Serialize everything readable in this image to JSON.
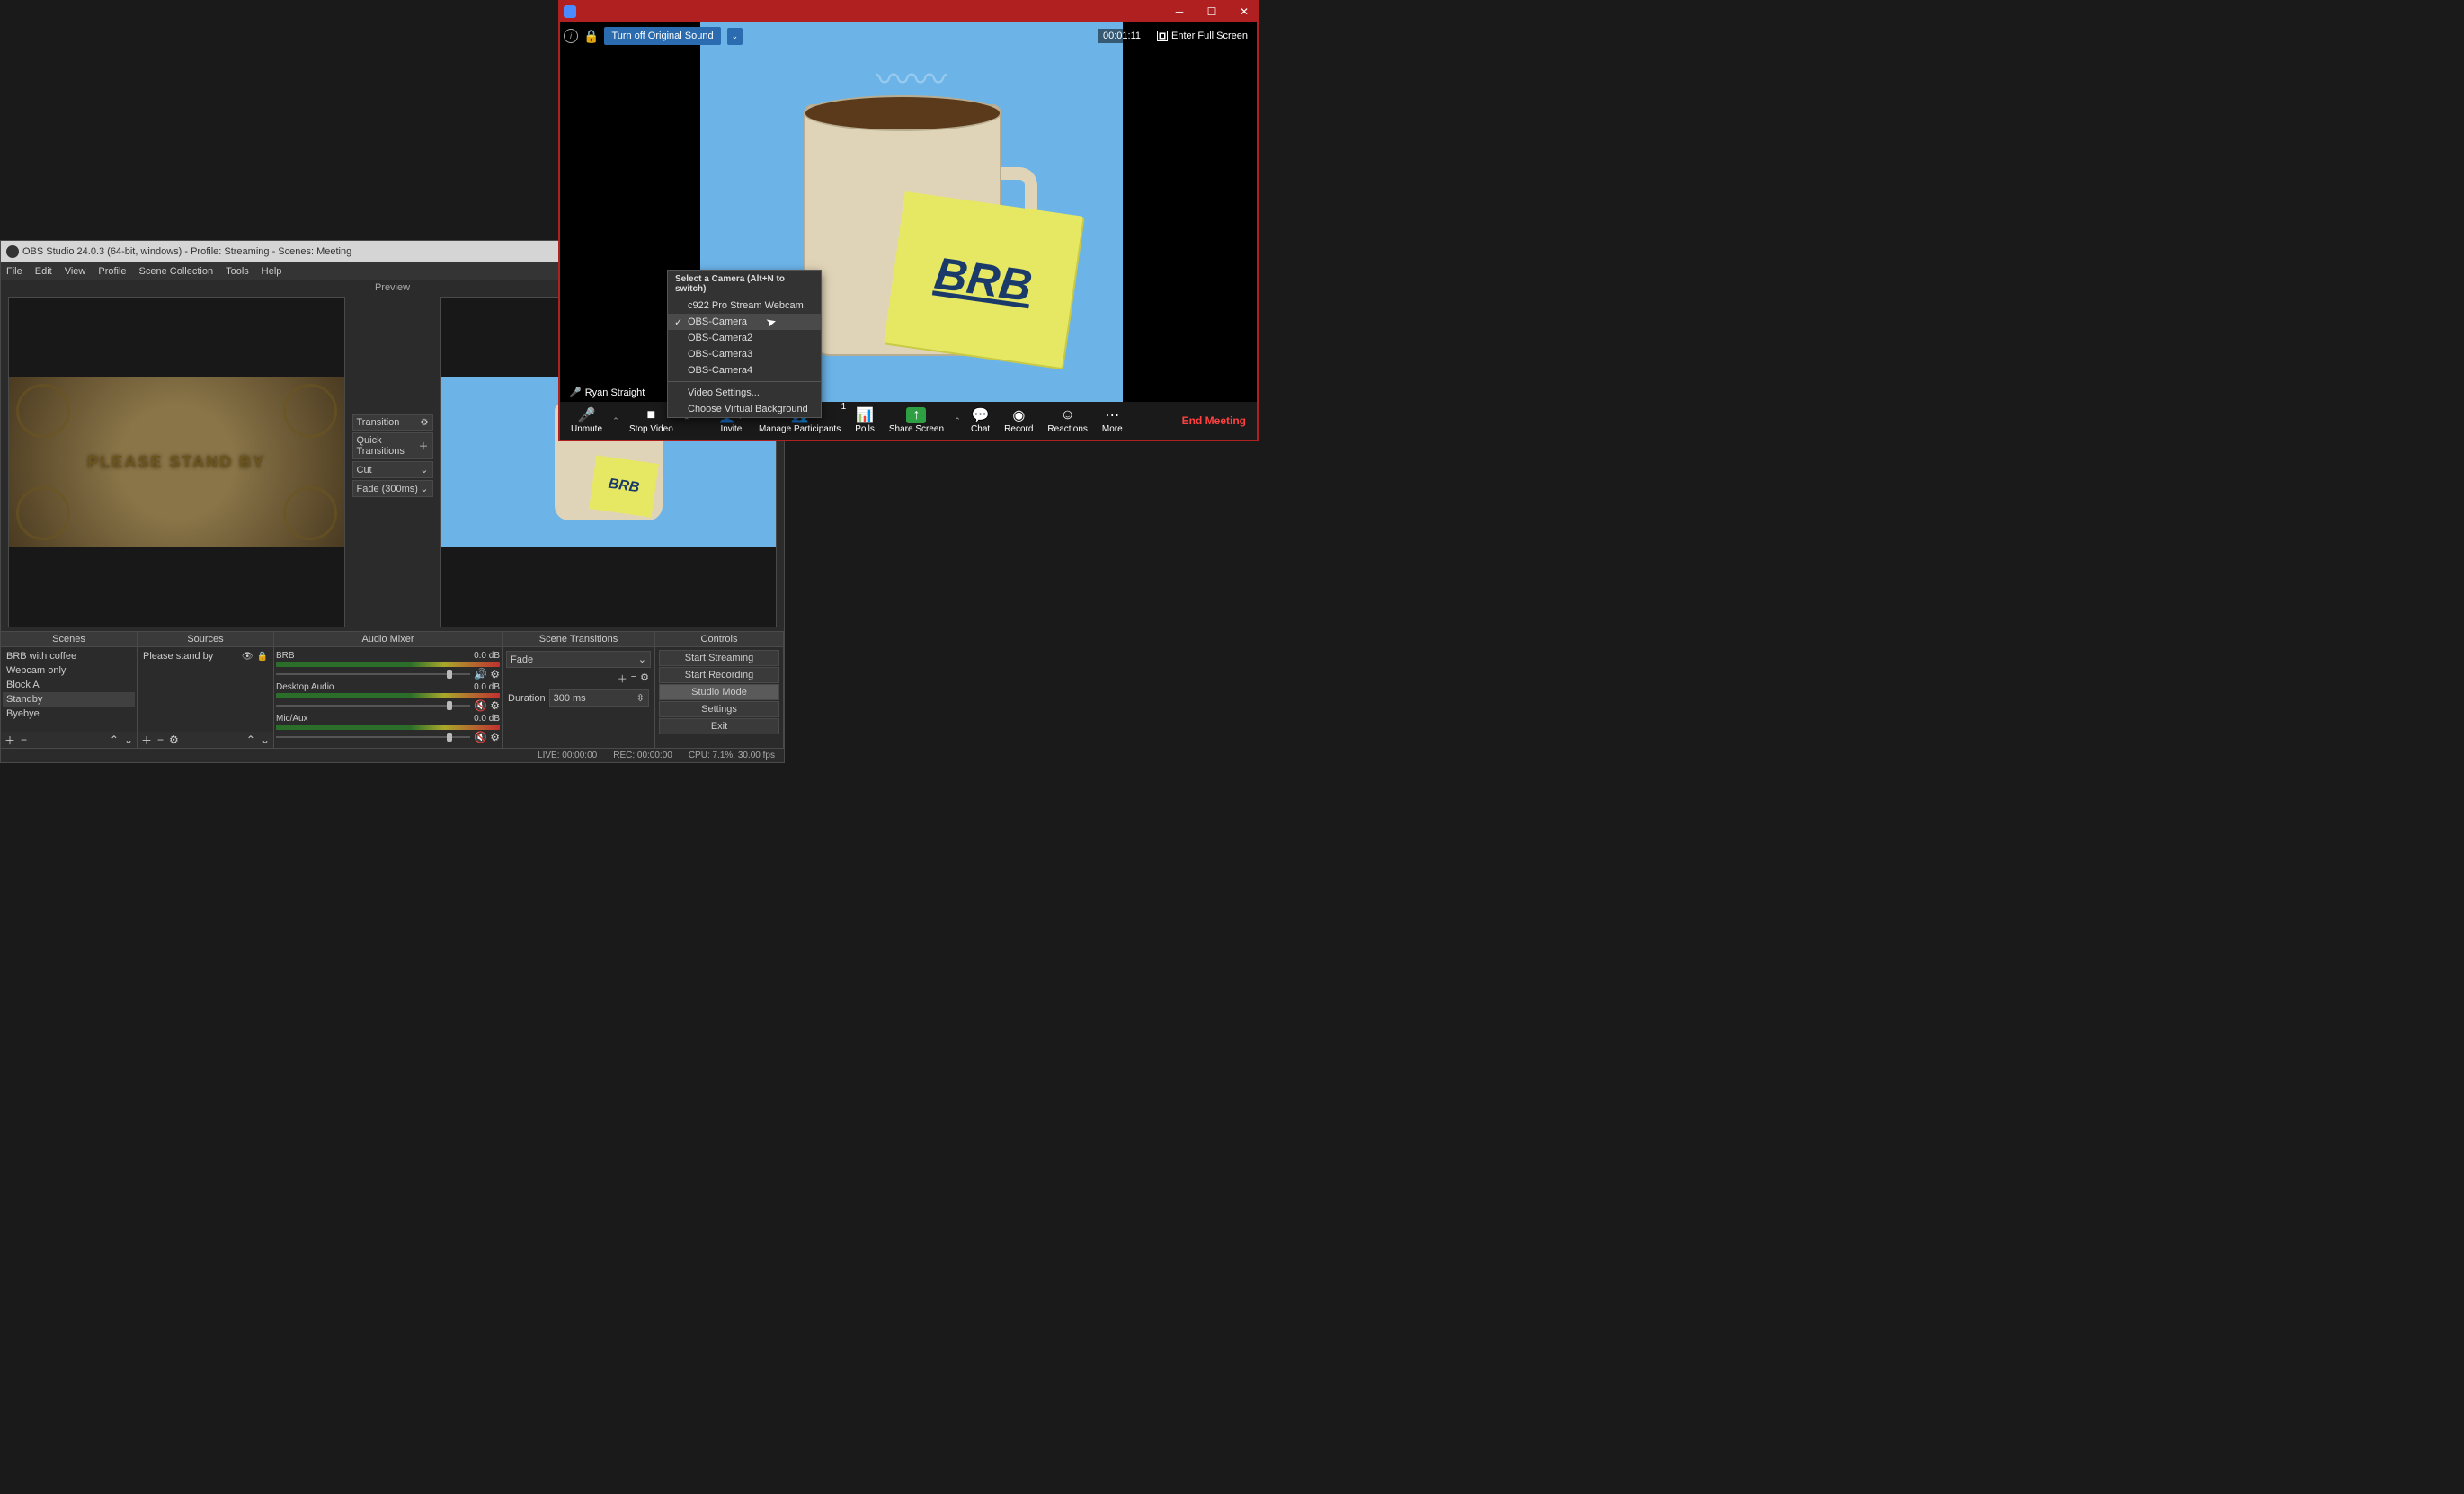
{
  "obs": {
    "title": "OBS Studio 24.0.3 (64-bit, windows) - Profile: Streaming - Scenes: Meeting",
    "menu": {
      "file": "File",
      "edit": "Edit",
      "view": "View",
      "profile": "Profile",
      "scenecol": "Scene Collection",
      "tools": "Tools",
      "help": "Help"
    },
    "preview_label": "Preview",
    "standby_text": "PLEASE STAND BY",
    "brb_text": "BRB",
    "transition": {
      "transition": "Transition",
      "quick": "Quick Transitions",
      "cut": "Cut",
      "fade": "Fade (300ms)"
    },
    "panels": {
      "scenes_title": "Scenes",
      "sources_title": "Sources",
      "mixer_title": "Audio Mixer",
      "trans_title": "Scene Transitions",
      "controls_title": "Controls"
    },
    "scenes": [
      "BRB with coffee",
      "Webcam only",
      "Block A",
      "Standby",
      "Byebye"
    ],
    "sources": [
      "Please stand by"
    ],
    "mixer": [
      {
        "name": "BRB",
        "db": "0.0 dB",
        "muted": false
      },
      {
        "name": "Desktop Audio",
        "db": "0.0 dB",
        "muted": true
      },
      {
        "name": "Mic/Aux",
        "db": "0.0 dB",
        "muted": true
      }
    ],
    "trans": {
      "type": "Fade",
      "dur_label": "Duration",
      "dur": "300 ms"
    },
    "controls": [
      "Start Streaming",
      "Start Recording",
      "Studio Mode",
      "Settings",
      "Exit"
    ],
    "status": {
      "live": "LIVE: 00:00:00",
      "rec": "REC: 00:00:00",
      "cpu": "CPU: 7.1%, 30.00 fps"
    }
  },
  "zoom": {
    "sound_btn": "Turn off Original Sound",
    "timer": "00:01:11",
    "fullscreen": "Enter Full Screen",
    "user": "Ryan Straight",
    "brb": "BRB",
    "toolbar": {
      "unmute": "Unmute",
      "stopvideo": "Stop Video",
      "invite": "Invite",
      "manage": "Manage Participants",
      "participants_count": "1",
      "polls": "Polls",
      "share": "Share Screen",
      "chat": "Chat",
      "record": "Record",
      "reactions": "Reactions",
      "more": "More",
      "end": "End Meeting"
    },
    "cam_popup": {
      "title": "Select a Camera (Alt+N to switch)",
      "items": [
        "c922 Pro Stream Webcam",
        "OBS-Camera",
        "OBS-Camera2",
        "OBS-Camera3",
        "OBS-Camera4"
      ],
      "video_settings": "Video Settings...",
      "virtual_bg": "Choose Virtual Background"
    }
  }
}
